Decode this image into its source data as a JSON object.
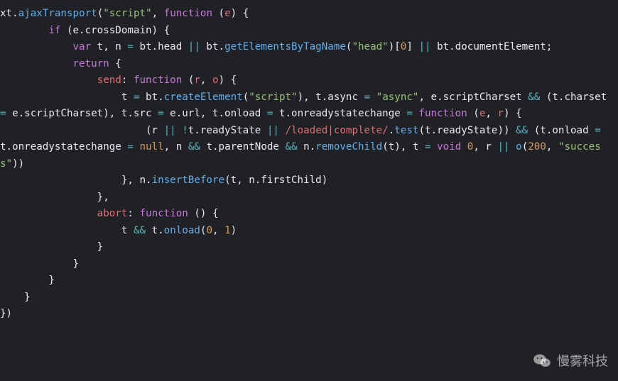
{
  "watermark": {
    "text": "慢雾科技"
  },
  "code": {
    "tokens": [
      {
        "t": "xt",
        "c": "w"
      },
      {
        "t": ".",
        "c": "w"
      },
      {
        "t": "ajaxTransport",
        "c": "fn"
      },
      {
        "t": "(",
        "c": "w"
      },
      {
        "t": "\"script\"",
        "c": "str"
      },
      {
        "t": ", ",
        "c": "w"
      },
      {
        "t": "function",
        "c": "kw"
      },
      {
        "t": " (",
        "c": "w"
      },
      {
        "t": "e",
        "c": "prm"
      },
      {
        "t": ") {",
        "c": "w"
      },
      {
        "t": "\n",
        "c": "w"
      },
      {
        "t": "        ",
        "c": "w"
      },
      {
        "t": "if",
        "c": "kw"
      },
      {
        "t": " (e.crossDomain) {",
        "c": "w"
      },
      {
        "t": "\n",
        "c": "w"
      },
      {
        "t": "            ",
        "c": "w"
      },
      {
        "t": "var",
        "c": "kw"
      },
      {
        "t": " t, n ",
        "c": "w"
      },
      {
        "t": "=",
        "c": "op"
      },
      {
        "t": " bt.head ",
        "c": "w"
      },
      {
        "t": "||",
        "c": "op"
      },
      {
        "t": " bt.",
        "c": "w"
      },
      {
        "t": "getElementsByTagName",
        "c": "fn"
      },
      {
        "t": "(",
        "c": "w"
      },
      {
        "t": "\"head\"",
        "c": "str"
      },
      {
        "t": ")[",
        "c": "w"
      },
      {
        "t": "0",
        "c": "num"
      },
      {
        "t": "] ",
        "c": "w"
      },
      {
        "t": "||",
        "c": "op"
      },
      {
        "t": " bt.documentElement;",
        "c": "w"
      },
      {
        "t": "\n",
        "c": "w"
      },
      {
        "t": "            ",
        "c": "w"
      },
      {
        "t": "return",
        "c": "kw"
      },
      {
        "t": " {",
        "c": "w"
      },
      {
        "t": "\n",
        "c": "w"
      },
      {
        "t": "                ",
        "c": "w"
      },
      {
        "t": "send",
        "c": "prop"
      },
      {
        "t": ": ",
        "c": "w"
      },
      {
        "t": "function",
        "c": "kw"
      },
      {
        "t": " (",
        "c": "w"
      },
      {
        "t": "r",
        "c": "prm"
      },
      {
        "t": ", ",
        "c": "w"
      },
      {
        "t": "o",
        "c": "prm"
      },
      {
        "t": ") {",
        "c": "w"
      },
      {
        "t": "\n",
        "c": "w"
      },
      {
        "t": "                    t ",
        "c": "w"
      },
      {
        "t": "=",
        "c": "op"
      },
      {
        "t": " bt.",
        "c": "w"
      },
      {
        "t": "createElement",
        "c": "fn"
      },
      {
        "t": "(",
        "c": "w"
      },
      {
        "t": "\"script\"",
        "c": "str"
      },
      {
        "t": "), t.async ",
        "c": "w"
      },
      {
        "t": "=",
        "c": "op"
      },
      {
        "t": " ",
        "c": "w"
      },
      {
        "t": "\"async\"",
        "c": "str"
      },
      {
        "t": ", e.scriptCharset ",
        "c": "w"
      },
      {
        "t": "&&",
        "c": "op"
      },
      {
        "t": " (t.charset ",
        "c": "w"
      },
      {
        "t": "=",
        "c": "op"
      },
      {
        "t": " e.scriptCharset), t.src ",
        "c": "w"
      },
      {
        "t": "=",
        "c": "op"
      },
      {
        "t": " e.url, t.onload ",
        "c": "w"
      },
      {
        "t": "=",
        "c": "op"
      },
      {
        "t": " t.onreadystatechange ",
        "c": "w"
      },
      {
        "t": "=",
        "c": "op"
      },
      {
        "t": " ",
        "c": "w"
      },
      {
        "t": "function",
        "c": "kw"
      },
      {
        "t": " (",
        "c": "w"
      },
      {
        "t": "e",
        "c": "prm"
      },
      {
        "t": ", ",
        "c": "w"
      },
      {
        "t": "r",
        "c": "prm"
      },
      {
        "t": ") {",
        "c": "w"
      },
      {
        "t": "\n",
        "c": "w"
      },
      {
        "t": "                        (r ",
        "c": "w"
      },
      {
        "t": "||",
        "c": "op"
      },
      {
        "t": " ",
        "c": "w"
      },
      {
        "t": "!",
        "c": "op"
      },
      {
        "t": "t.readyState ",
        "c": "w"
      },
      {
        "t": "||",
        "c": "op"
      },
      {
        "t": " ",
        "c": "w"
      },
      {
        "t": "/loaded|complete/",
        "c": "rgx"
      },
      {
        "t": ".",
        "c": "w"
      },
      {
        "t": "test",
        "c": "fn"
      },
      {
        "t": "(t.readyState)) ",
        "c": "w"
      },
      {
        "t": "&&",
        "c": "op"
      },
      {
        "t": " (t.onload ",
        "c": "w"
      },
      {
        "t": "=",
        "c": "op"
      },
      {
        "t": " t.onreadystatechange ",
        "c": "w"
      },
      {
        "t": "=",
        "c": "op"
      },
      {
        "t": " ",
        "c": "w"
      },
      {
        "t": "null",
        "c": "cnst"
      },
      {
        "t": ", n ",
        "c": "w"
      },
      {
        "t": "&&",
        "c": "op"
      },
      {
        "t": " t.parentNode ",
        "c": "w"
      },
      {
        "t": "&&",
        "c": "op"
      },
      {
        "t": " n.",
        "c": "w"
      },
      {
        "t": "removeChild",
        "c": "fn"
      },
      {
        "t": "(t), t ",
        "c": "w"
      },
      {
        "t": "=",
        "c": "op"
      },
      {
        "t": " ",
        "c": "w"
      },
      {
        "t": "void",
        "c": "kw"
      },
      {
        "t": " ",
        "c": "w"
      },
      {
        "t": "0",
        "c": "num"
      },
      {
        "t": ", r ",
        "c": "w"
      },
      {
        "t": "||",
        "c": "op"
      },
      {
        "t": " ",
        "c": "w"
      },
      {
        "t": "o",
        "c": "fn"
      },
      {
        "t": "(",
        "c": "w"
      },
      {
        "t": "200",
        "c": "num"
      },
      {
        "t": ", ",
        "c": "w"
      },
      {
        "t": "\"success\"",
        "c": "str"
      },
      {
        "t": "))",
        "c": "w"
      },
      {
        "t": "\n",
        "c": "w"
      },
      {
        "t": "                    }, n.",
        "c": "w"
      },
      {
        "t": "insertBefore",
        "c": "fn"
      },
      {
        "t": "(t, n.firstChild)",
        "c": "w"
      },
      {
        "t": "\n",
        "c": "w"
      },
      {
        "t": "                },",
        "c": "w"
      },
      {
        "t": "\n",
        "c": "w"
      },
      {
        "t": "                ",
        "c": "w"
      },
      {
        "t": "abort",
        "c": "prop"
      },
      {
        "t": ": ",
        "c": "w"
      },
      {
        "t": "function",
        "c": "kw"
      },
      {
        "t": " () {",
        "c": "w"
      },
      {
        "t": "\n",
        "c": "w"
      },
      {
        "t": "                    t ",
        "c": "w"
      },
      {
        "t": "&&",
        "c": "op"
      },
      {
        "t": " t.",
        "c": "w"
      },
      {
        "t": "onload",
        "c": "fn"
      },
      {
        "t": "(",
        "c": "w"
      },
      {
        "t": "0",
        "c": "num"
      },
      {
        "t": ", ",
        "c": "w"
      },
      {
        "t": "1",
        "c": "num"
      },
      {
        "t": ")",
        "c": "w"
      },
      {
        "t": "\n",
        "c": "w"
      },
      {
        "t": "                }",
        "c": "w"
      },
      {
        "t": "\n",
        "c": "w"
      },
      {
        "t": "            }",
        "c": "w"
      },
      {
        "t": "\n",
        "c": "w"
      },
      {
        "t": "        }",
        "c": "w"
      },
      {
        "t": "\n",
        "c": "w"
      },
      {
        "t": "    }",
        "c": "w"
      },
      {
        "t": "\n",
        "c": "w"
      },
      {
        "t": "})",
        "c": "w"
      }
    ]
  }
}
